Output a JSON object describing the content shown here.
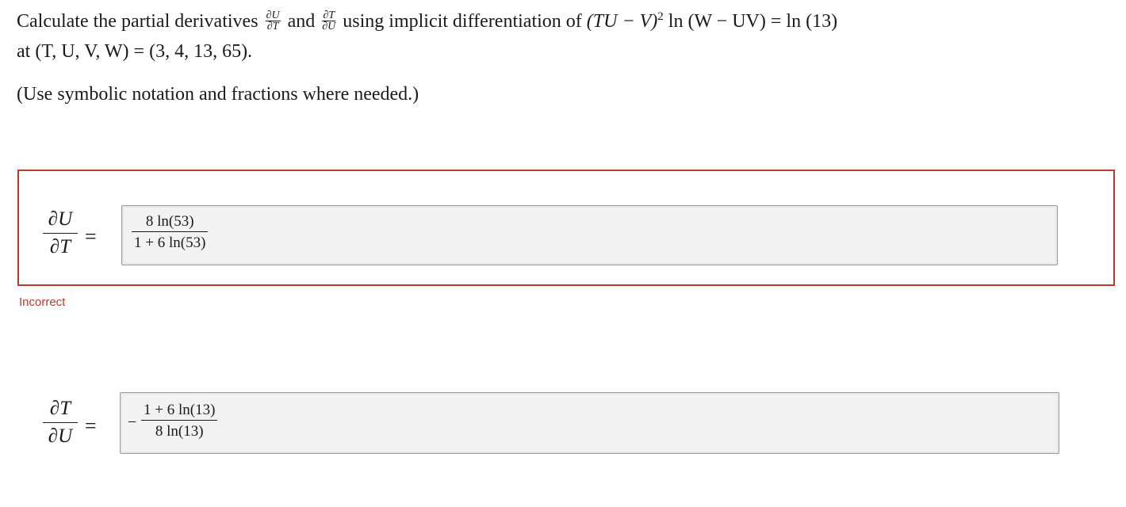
{
  "question": {
    "line1_prefix": "Calculate the partial derivatives",
    "frac1_num": "∂U",
    "frac1_den": "∂T",
    "and_word": "and",
    "frac2_num": "∂T",
    "frac2_den": "∂U",
    "line1_middle": "using implicit differentiation of",
    "equation_left": "(TU − V)",
    "equation_power": "2",
    "equation_right": "ln (W − UV) = ln (13)",
    "line2": "at (T, U, V, W) = (3, 4, 13, 65).",
    "hint": "(Use symbolic notation and fractions where needed.)"
  },
  "answers": [
    {
      "lhs_num": "∂U",
      "lhs_den": "∂T",
      "equals": "=",
      "negative": false,
      "value_num": "8 ln(53)",
      "value_den": "1 + 6 ln(53)",
      "status": "Incorrect"
    },
    {
      "lhs_num": "∂T",
      "lhs_den": "∂U",
      "equals": "=",
      "negative": true,
      "neg_symbol": "−",
      "value_num": "1 + 6 ln(13)",
      "value_den": "8 ln(13)",
      "status": ""
    }
  ],
  "colors": {
    "incorrect": "#c0392b",
    "field_background": "#f2f2f2",
    "text": "#1a1a1a"
  }
}
